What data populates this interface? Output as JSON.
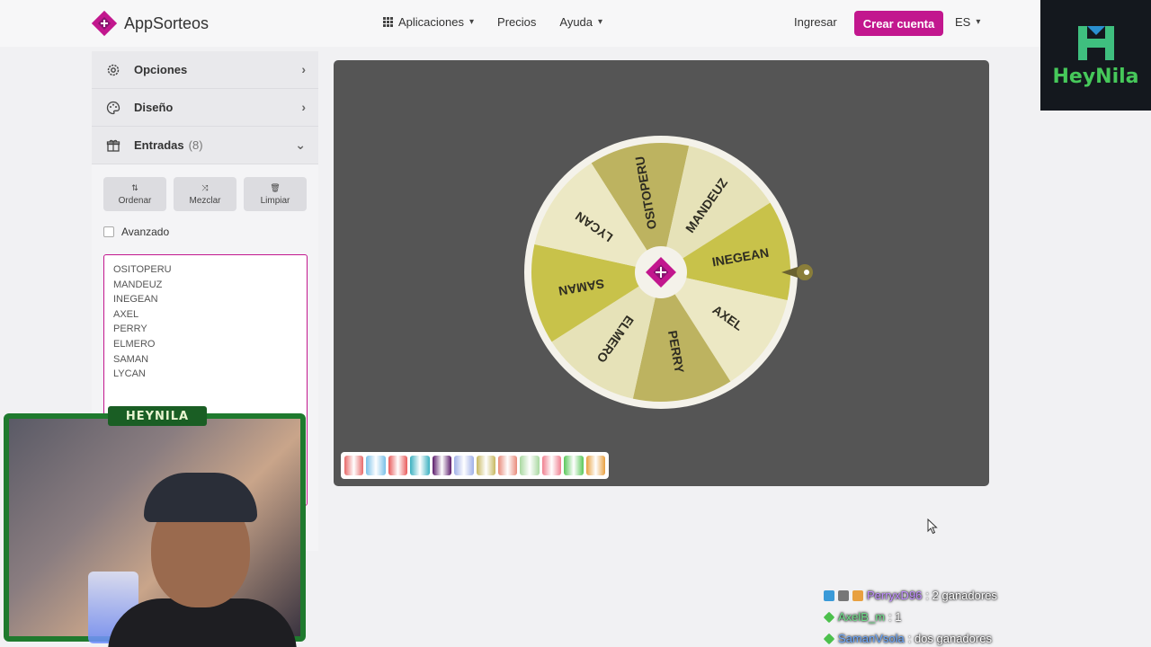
{
  "header": {
    "brand": "AppSorteos",
    "nav": [
      {
        "label": "Aplicaciones",
        "has_dropdown": true,
        "icon": "grid-icon"
      },
      {
        "label": "Precios",
        "has_dropdown": false
      },
      {
        "label": "Ayuda",
        "has_dropdown": true
      }
    ],
    "login_label": "Ingresar",
    "cta_label": "Crear cuenta",
    "lang_label": "ES",
    "accent_color": "#c2178e"
  },
  "sidebar": {
    "options_label": "Opciones",
    "design_label": "Diseño",
    "entries_label": "Entradas",
    "entries_count": "(8)",
    "tools": [
      {
        "label": "Ordenar",
        "icon": "sort-icon"
      },
      {
        "label": "Mezclar",
        "icon": "shuffle-icon"
      },
      {
        "label": "Limpiar",
        "icon": "trash-icon"
      }
    ],
    "advanced_label": "Avanzado",
    "entries": [
      "OSITOPERU",
      "MANDEUZ",
      "INEGEAN",
      "AXEL",
      "PERRY",
      "ELMERO",
      "SAMAN",
      "LYCAN"
    ]
  },
  "wheel": {
    "segments": [
      "OSITOPERU",
      "MANDEUZ",
      "INEGEAN",
      "AXEL",
      "PERRY",
      "ELMERO",
      "SAMAN",
      "LYCAN"
    ],
    "colors": [
      "#bdb360",
      "#e6e2b8",
      "#c8c24a",
      "#ece8c4",
      "#bdb360",
      "#e6e2b8",
      "#c8c24a",
      "#ece8c4"
    ],
    "rim_color": "#f4f2ea",
    "stage_color": "#555555"
  },
  "palette": [
    "#e86a6a",
    "#7ac0e8",
    "#e85a5a",
    "#3ab0c0",
    "#5a1a6a",
    "#a0b0e8",
    "#c8b860",
    "#e88a7a",
    "#a8d8a0",
    "#f08090",
    "#5ac85a",
    "#e8a040"
  ],
  "stream": {
    "cam_label": "HEYNILA",
    "brand_text": "HeyNila"
  },
  "chat": [
    {
      "user": "PerryxD96",
      "message": ": 2 ganadores"
    },
    {
      "user": "AxelB_m",
      "message": ": 1"
    },
    {
      "user": "SamanVsola",
      "message": ": dos ganadores"
    }
  ]
}
